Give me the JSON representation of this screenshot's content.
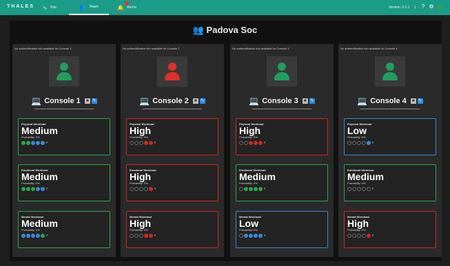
{
  "topbar": {
    "brand": "THALES",
    "tabs": [
      {
        "label": "Site",
        "icon": "chart-icon"
      },
      {
        "label": "Team",
        "icon": "team-icon",
        "active": true
      },
      {
        "label": "Alerts",
        "icon": "bell-icon"
      }
    ],
    "version": "Version: 2.1.1",
    "colors": {
      "bar": "#1a9c88",
      "status_dot": "#2ea44f"
    }
  },
  "site": {
    "title": "Padova Soc",
    "icon": "team-icon"
  },
  "columns": [
    {
      "note": "No authentification info available for Console 1",
      "console": "Console 1",
      "avatar_color": "#1f9e5e",
      "cards": [
        {
          "label": "Physical Workload",
          "level": "Medium",
          "prob": "Probability: 0%",
          "border": "green",
          "dots": [
            "#2ea44f",
            "#2ea44f",
            "#3f87d8",
            "#3f87d8",
            "#3f87d8"
          ]
        },
        {
          "label": "Emotional Workload",
          "level": "Medium",
          "prob": "Probability: 0%",
          "border": "green",
          "dots": [
            "#2ea44f",
            "#2ea44f",
            "#2ea44f",
            "#3f87d8",
            "#3f87d8"
          ]
        },
        {
          "label": "Mental Workload",
          "level": "Medium",
          "prob": "Probability: 0%",
          "border": "green",
          "dots": [
            "#3f87d8",
            "#3f87d8",
            "#3f87d8",
            "#3f87d8",
            "#2ea44f"
          ]
        }
      ]
    },
    {
      "note": "No authentification info available for Console 2",
      "console": "Console 2",
      "avatar_color": "#e0302a",
      "cards": [
        {
          "label": "Physical Workload",
          "level": "High",
          "prob": "Probability: 0%",
          "border": "red",
          "dots": [
            "empty",
            "empty",
            "empty",
            "#d12727",
            "#d12727"
          ]
        },
        {
          "label": "Emotional Workload",
          "level": "High",
          "prob": "Probability: 0%",
          "border": "red",
          "dots": [
            "empty",
            "empty",
            "empty",
            "empty",
            "#d12727"
          ]
        },
        {
          "label": "Mental Workload",
          "level": "High",
          "prob": "Probability: 0%",
          "border": "red",
          "dots": [
            "empty",
            "empty",
            "empty",
            "#d12727",
            "#d12727"
          ]
        }
      ]
    },
    {
      "note": "No authentification info available for Console 3",
      "console": "Console 3",
      "avatar_color": "#1f9e5e",
      "cards": [
        {
          "label": "Physical Workload",
          "level": "High",
          "prob": "Probability: 0%",
          "border": "red",
          "dots": [
            "empty",
            "empty",
            "#d12727",
            "#d12727",
            "#d12727"
          ]
        },
        {
          "label": "Emotional Workload",
          "level": "Medium",
          "prob": "Probability: 0%",
          "border": "green",
          "dots": [
            "empty",
            "#2ea44f",
            "#2ea44f",
            "#2ea44f",
            "#2ea44f"
          ]
        },
        {
          "label": "Mental Workload",
          "level": "Low",
          "prob": "Probability: 0%",
          "border": "blue",
          "dots": [
            "empty",
            "#3f87d8",
            "#3f87d8",
            "#3f87d8",
            "#3f87d8"
          ]
        }
      ]
    },
    {
      "note": "No authentification info available for Console 4",
      "console": "Console 4",
      "avatar_color": "#1f9e5e",
      "cards": [
        {
          "label": "Physical Workload",
          "level": "Low",
          "prob": "Probability: 0%",
          "border": "blue",
          "dots": [
            "empty",
            "empty",
            "empty",
            "empty",
            "#3f87d8"
          ]
        },
        {
          "label": "Emotional Workload",
          "level": "Medium",
          "prob": "Probability: 0%",
          "border": "green",
          "dots": [
            "empty",
            "empty",
            "empty",
            "empty",
            "empty"
          ]
        },
        {
          "label": "Mental Workload",
          "level": "High",
          "prob": "Probability: 0%",
          "border": "red",
          "dots": [
            "empty",
            "empty",
            "empty",
            "empty",
            "#d12727"
          ]
        }
      ]
    }
  ]
}
